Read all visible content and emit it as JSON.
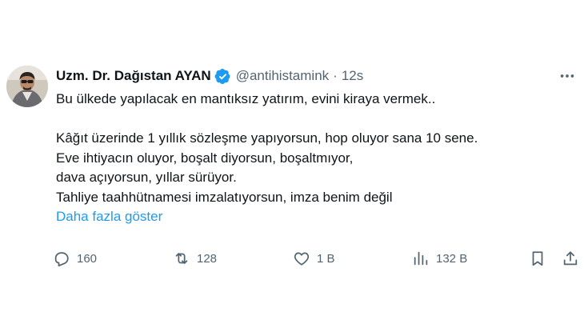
{
  "author": {
    "display_name": "Uzm. Dr. Dağıstan AYAN",
    "handle": "@antihistamink",
    "separator": "·",
    "time": "12s",
    "verified_color": "#1d9bf0"
  },
  "tweet": {
    "lines": [
      "Bu ülkede yapılacak en mantıksız yatırım, evini kiraya vermek..",
      "",
      "Kâğıt üzerinde 1 yıllık sözleşme yapıyorsun, hop oluyor sana 10 sene.",
      "Eve ihtiyacın oluyor, boşalt diyorsun, boşaltmıyor,",
      "dava açıyorsun, yıllar sürüyor.",
      "Tahliye taahhütnamesi imzalatıyorsun, imza benim değil"
    ],
    "show_more": "Daha fazla göster"
  },
  "actions": {
    "reply": {
      "icon": "reply-icon",
      "count": "160"
    },
    "retweet": {
      "icon": "retweet-icon",
      "count": "128"
    },
    "like": {
      "icon": "heart-icon",
      "count": "1 B"
    },
    "views": {
      "icon": "views-icon",
      "count": "132 B"
    },
    "bookmark": {
      "icon": "bookmark-icon"
    },
    "share": {
      "icon": "share-icon"
    }
  },
  "colors": {
    "text": "#0f1419",
    "secondary": "#536471",
    "link": "#1d9bf0"
  }
}
